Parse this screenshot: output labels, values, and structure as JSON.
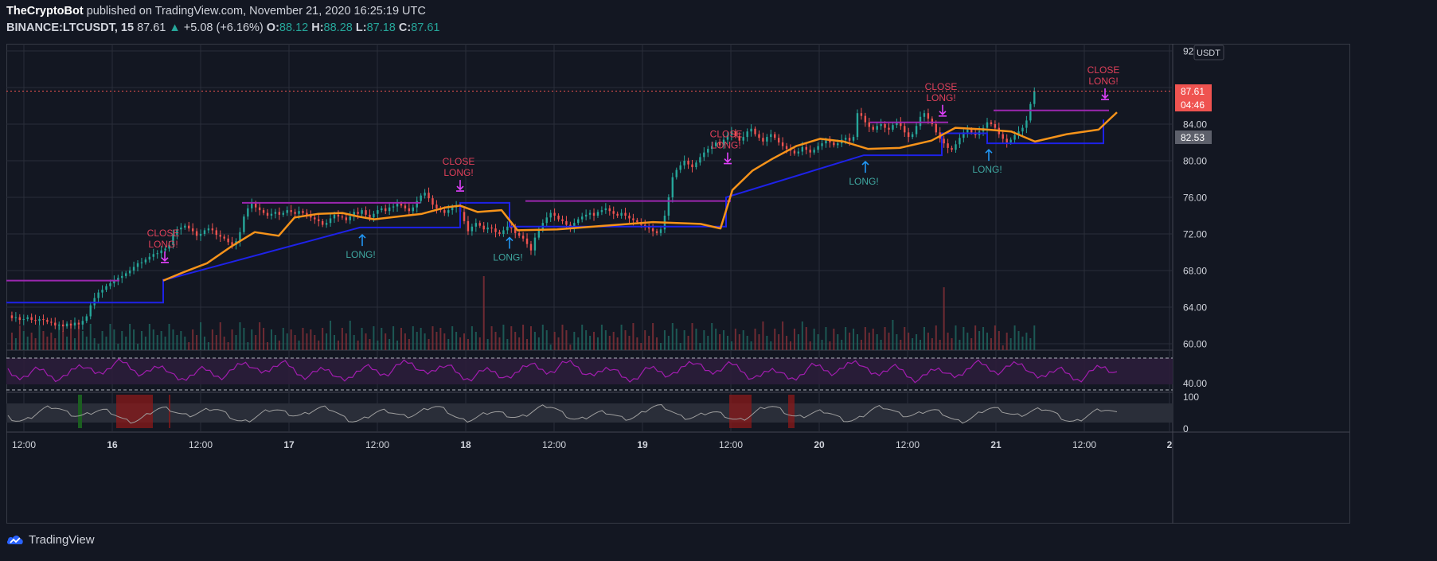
{
  "header": {
    "author": "TheCryptoBot",
    "published_text": "published on TradingView.com, November 21, 2020 16:25:19 UTC",
    "symbol": "BINANCE:LTCUSDT, 15",
    "last": "87.61",
    "change": "+5.08 (+6.16%)",
    "o_label": "O:",
    "o": "88.12",
    "h_label": "H:",
    "h": "88.28",
    "l_label": "L:",
    "l": "87.18",
    "c_label": "C:",
    "c": "87.61"
  },
  "price_axis": {
    "currency": "USDT",
    "last_price_label": "87.61",
    "countdown_label": "04:46",
    "level_label": "82.53"
  },
  "footer": {
    "brand": "TradingView"
  },
  "colors": {
    "background": "#131722",
    "up": "#26a69a",
    "down": "#ef5350",
    "ema": "#f7931a",
    "stop": "#1e22e8",
    "target": "#9c27b0",
    "signal_close": "#e0405a",
    "signal_long": "#3fa7a0",
    "arrow_close": "#e040fb",
    "arrow_long": "#2196f3"
  },
  "chart_data": {
    "type": "candlestick",
    "symbol": "BINANCE:LTCUSDT",
    "interval": "15",
    "price_ticks": [
      "92.00",
      "88.00",
      "84.00",
      "80.00",
      "76.00",
      "72.00",
      "68.00",
      "64.00",
      "60.00"
    ],
    "ylim": [
      60,
      92
    ],
    "x_ticks": [
      "12:00",
      "16",
      "12:00",
      "17",
      "12:00",
      "18",
      "12:00",
      "19",
      "12:00",
      "20",
      "12:00",
      "21",
      "12:00",
      "2"
    ],
    "close_series": {
      "x": [
        0,
        2,
        4,
        6,
        8,
        10,
        12,
        14,
        16,
        18,
        20,
        22,
        24,
        26,
        28,
        30,
        32,
        34,
        36,
        38,
        40,
        42,
        44,
        46,
        48,
        50,
        52,
        54,
        56,
        58,
        60,
        62,
        64,
        66,
        68,
        70,
        72,
        74,
        76,
        78,
        80,
        82,
        84,
        86,
        88,
        90,
        92,
        94,
        96,
        98,
        100,
        102,
        104,
        106,
        108,
        110,
        112,
        114,
        116,
        118,
        120,
        122,
        124,
        126,
        128,
        130,
        132,
        134,
        136,
        138,
        140,
        142,
        144,
        146,
        148,
        150,
        152,
        154,
        156,
        158,
        160,
        162,
        164,
        166,
        168,
        170,
        172,
        174,
        176,
        178,
        180,
        182,
        184,
        186,
        188,
        190,
        192,
        194,
        196,
        198,
        200,
        202,
        204,
        206,
        208,
        210,
        212,
        214,
        216,
        218,
        220,
        222,
        224,
        226,
        228,
        230,
        232,
        234,
        236,
        238,
        240,
        242,
        244,
        246,
        248,
        250,
        252,
        254,
        256,
        258,
        260,
        262,
        264,
        266,
        268,
        270,
        272,
        274,
        276,
        278,
        280,
        282,
        284,
        286,
        288,
        290,
        292,
        294,
        296,
        298,
        300,
        302,
        304,
        306,
        308,
        310,
        312,
        314,
        316,
        318,
        320,
        322,
        324,
        326,
        328,
        330,
        332,
        334,
        336,
        338,
        340,
        342,
        344,
        346,
        348,
        350,
        352,
        354,
        356,
        358,
        360,
        362,
        364,
        366,
        368,
        370,
        372,
        374,
        376,
        378,
        380,
        382,
        384,
        386,
        388,
        390,
        392,
        394,
        396,
        398,
        400,
        402,
        404,
        406,
        408,
        410,
        412,
        414,
        416,
        418,
        420,
        422,
        424,
        426,
        428,
        430,
        432,
        434,
        436,
        438,
        440,
        442,
        444,
        446,
        448,
        450,
        452,
        454,
        456,
        458,
        460,
        462,
        464,
        466,
        468,
        470,
        472,
        474,
        476,
        478,
        480,
        482,
        484,
        486,
        488,
        490,
        492,
        494,
        496,
        498,
        500,
        502,
        504,
        506,
        508,
        510,
        512,
        514,
        516,
        518,
        520,
        522,
        524,
        526,
        528,
        530,
        532,
        534,
        536,
        538,
        540,
        542,
        544,
        546,
        548,
        550,
        552,
        554,
        556,
        558,
        560,
        562,
        564
      ],
      "close": [
        63.1,
        62.8,
        62.9,
        62.6,
        62.7,
        62.9,
        62.6,
        62.5,
        62.7,
        62.6,
        62.4,
        62.3,
        62.0,
        62.1,
        61.9,
        62.2,
        62.0,
        62.3,
        62.1,
        62.5,
        63.0,
        64.2,
        65.0,
        65.6,
        65.9,
        66.3,
        66.6,
        66.9,
        67.2,
        67.4,
        67.7,
        68.0,
        68.4,
        68.8,
        68.9,
        69.2,
        69.5,
        69.8,
        69.9,
        70.2,
        70.4,
        70.8,
        71.9,
        72.5,
        72.7,
        72.9,
        72.6,
        72.3,
        71.8,
        72.0,
        72.4,
        72.6,
        72.4,
        71.9,
        71.7,
        71.5,
        71.1,
        70.8,
        71.2,
        72.2,
        73.9,
        74.8,
        75.3,
        74.9,
        74.6,
        74.3,
        74.0,
        74.2,
        74.4,
        74.1,
        74.3,
        74.6,
        74.4,
        74.2,
        74.5,
        74.3,
        74.0,
        73.8,
        73.6,
        73.4,
        73.0,
        73.2,
        73.7,
        74.1,
        73.9,
        73.8,
        73.5,
        73.9,
        74.4,
        74.2,
        74.6,
        74.1,
        73.8,
        74.2,
        74.6,
        74.8,
        74.5,
        74.9,
        75.0,
        75.3,
        75.1,
        74.8,
        74.5,
        74.9,
        75.6,
        76.2,
        76.5,
        75.9,
        75.2,
        74.8,
        74.6,
        74.3,
        74.6,
        74.9,
        75.1,
        74.4,
        73.4,
        72.3,
        72.8,
        73.2,
        72.9,
        72.5,
        72.7,
        72.6,
        72.2,
        72.0,
        72.4,
        72.8,
        72.6,
        72.1,
        71.8,
        71.5,
        70.9,
        70.2,
        71.6,
        72.5,
        73.2,
        73.8,
        74.3,
        74.0,
        73.6,
        73.4,
        73.0,
        72.7,
        73.2,
        73.6,
        73.9,
        74.1,
        74.3,
        74.0,
        74.4,
        74.6,
        74.8,
        74.5,
        74.2,
        74.0,
        74.3,
        74.0,
        73.7,
        73.5,
        73.3,
        73.0,
        72.8,
        72.6,
        72.3,
        72.1,
        72.5,
        74.0,
        76.0,
        78.2,
        79.0,
        79.5,
        80.0,
        79.6,
        79.3,
        79.8,
        80.4,
        80.9,
        81.3,
        81.6,
        82.0,
        81.7,
        82.3,
        82.8,
        83.2,
        82.7,
        82.2,
        82.6,
        83.2,
        83.5,
        82.9,
        82.5,
        82.1,
        82.6,
        82.9,
        82.5,
        82.0,
        81.6,
        81.3,
        81.1,
        80.8,
        81.0,
        81.5,
        81.2,
        80.9,
        81.2,
        81.6,
        81.9,
        82.2,
        82.0,
        81.7,
        81.9,
        82.3,
        82.5,
        82.2,
        82.6,
        85.2,
        84.9,
        84.2,
        83.7,
        83.4,
        83.8,
        84.0,
        83.6,
        83.4,
        83.9,
        84.2,
        83.8,
        83.1,
        82.6,
        82.9,
        83.8,
        84.8,
        85.2,
        84.6,
        84.0,
        83.1,
        82.4,
        81.9,
        81.4,
        81.2,
        81.8,
        82.5,
        83.1,
        83.4,
        83.1,
        82.8,
        83.2,
        83.6,
        84.2,
        84.0,
        83.6,
        82.9,
        82.4,
        82.0,
        82.3,
        82.8,
        83.2,
        83.6,
        84.4,
        86.2,
        87.6
      ]
    },
    "ema_series": {
      "x": [
        144,
        150,
        160,
        170,
        180,
        190,
        200,
        210,
        220,
        230,
        240,
        250,
        260,
        270,
        280,
        290,
        300,
        310,
        320,
        330,
        340,
        350,
        360,
        370,
        380,
        390,
        400,
        410,
        420,
        430,
        440,
        450,
        460,
        470,
        480,
        490,
        500,
        510,
        520,
        530,
        540,
        550,
        560,
        564
      ],
      "y": [
        67.1,
        67.5,
        68.2,
        68.9,
        69.6,
        70.5,
        71.3,
        71.9,
        72.4,
        72.2,
        72.0,
        71.8,
        72.3,
        73.6,
        74.1,
        74.1,
        74.2,
        74.0,
        73.7,
        73.7,
        73.9,
        74.1,
        74.6,
        74.8,
        75.2,
        74.9,
        74.6,
        75.0,
        73.2,
        75.0,
        76.0,
        76.2,
        76.0,
        76.1,
        76.3,
        76.0,
        75.9,
        76.0,
        76.3,
        76.5,
        76.2,
        76.1,
        76.4,
        76.6
      ]
    },
    "stop_levels": [
      {
        "from_x": 0,
        "to_x": 144,
        "price": 64.5
      },
      {
        "from_x": 144,
        "to_x": 240,
        "price": 67.0
      },
      {
        "from_x": 240,
        "to_x": 250,
        "price": 72.7
      },
      {
        "from_x": 250,
        "to_x": 286,
        "price": 72.7
      }
    ],
    "signals": [
      {
        "type": "CLOSE LONG!",
        "x_label": "15 16:15",
        "price": 68.8
      },
      {
        "type": "LONG!",
        "x_label": "17 08:45",
        "price": 72.6
      },
      {
        "type": "CLOSE LONG!",
        "x_label": "18 00:00",
        "price": 76.6
      },
      {
        "type": "LONG!",
        "x_label": "18 11:30",
        "price": 72.3
      },
      {
        "type": "CLOSE LONG!",
        "x_label": "19 12:00",
        "price": 79.6
      },
      {
        "type": "LONG!",
        "x_label": "20 10:30",
        "price": 80.6
      },
      {
        "type": "CLOSE LONG!",
        "x_label": "20 15:30",
        "price": 84.8
      },
      {
        "type": "LONG!",
        "x_label": "20 21:45",
        "price": 81.9
      },
      {
        "type": "CLOSE LONG!",
        "x_label": "21 14:45",
        "price": 86.6
      }
    ],
    "rsi_ticks": [
      "40.00"
    ],
    "oscillator_ticks": [
      "100",
      "0"
    ]
  }
}
